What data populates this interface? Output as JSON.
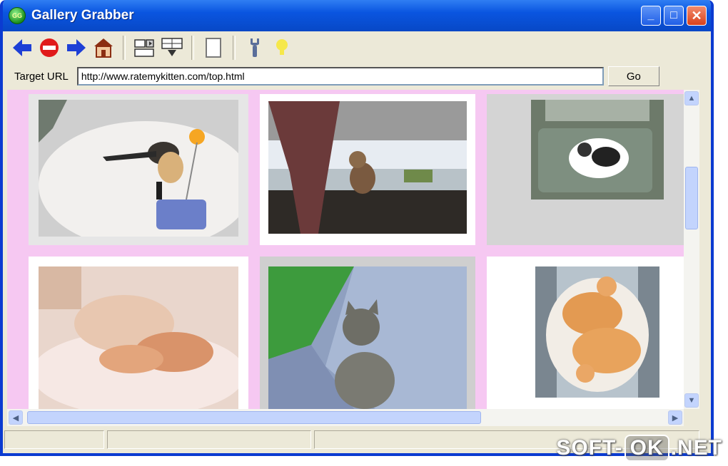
{
  "window": {
    "title": "Gallery Grabber",
    "app_icon_text": "GG",
    "controls": {
      "minimize": "_",
      "maximize": "□",
      "close": "✕"
    }
  },
  "toolbar": {
    "buttons": [
      {
        "name": "back-arrow-icon",
        "color": "#1d3fd6"
      },
      {
        "name": "stop-icon",
        "color": "#e01a1a"
      },
      {
        "name": "forward-arrow-icon",
        "color": "#1d3fd6"
      },
      {
        "name": "home-icon",
        "color": "#a0522d"
      },
      {
        "name": "layout-columns-icon",
        "color": "#3a3a3a"
      },
      {
        "name": "download-grid-icon",
        "color": "#3a3a3a"
      },
      {
        "name": "blank-page-icon",
        "color": "#9a9a9a"
      },
      {
        "name": "wrench-icon",
        "color": "#5a6e9a"
      },
      {
        "name": "lightbulb-icon",
        "color": "#f6e84a"
      }
    ]
  },
  "url_bar": {
    "label": "Target URL",
    "value": "http://www.ratemykitten.com/top.html",
    "go_label": "Go"
  },
  "gallery": {
    "background": "#f6c8f2",
    "thumbnails": [
      {
        "name": "kitten-playing-with-toy"
      },
      {
        "name": "kitten-on-windowsill"
      },
      {
        "name": "kittens-in-sink"
      },
      {
        "name": "sleeping-ginger-kittens"
      },
      {
        "name": "tabby-kitten-on-blanket"
      },
      {
        "name": "ginger-kittens-in-bowl"
      }
    ]
  },
  "watermark": {
    "left": "SOFT-",
    "ok": "OK",
    "right": ".NET"
  },
  "colors": {
    "titlebar": "#0a55e0",
    "window_border": "#0b3bd1",
    "chrome": "#ece9d8",
    "scrollbar_thumb": "#c3d4fd"
  }
}
